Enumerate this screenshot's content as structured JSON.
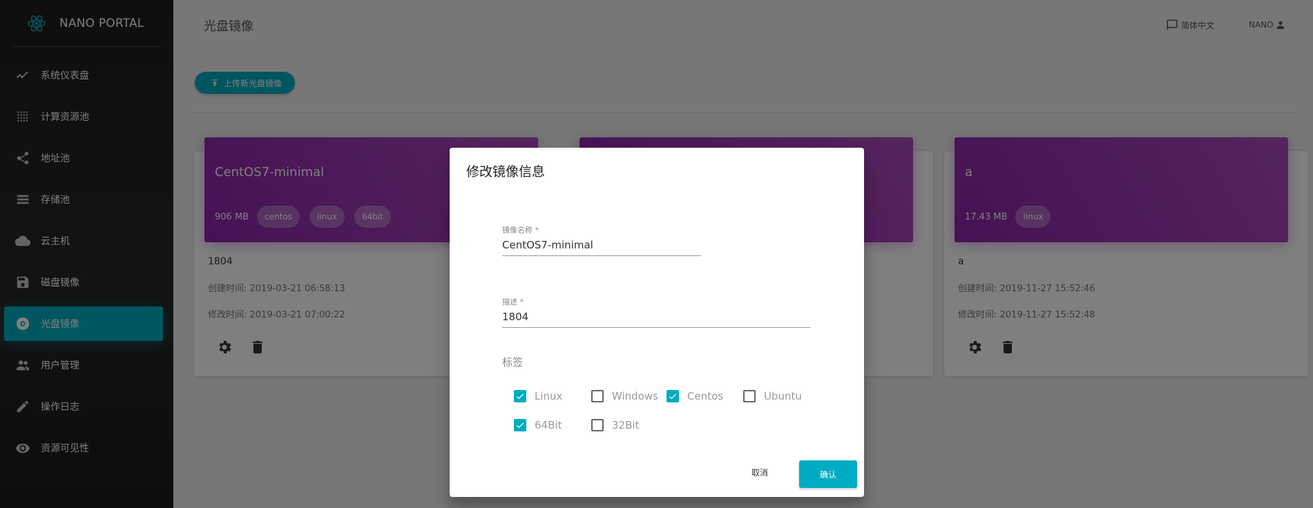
{
  "app": {
    "title": "NANO PORTAL",
    "logo_icon": "react-atom-icon"
  },
  "sidebar": {
    "items": [
      {
        "label": "系统仪表盘",
        "icon": "trending-icon"
      },
      {
        "label": "计算资源池",
        "icon": "grid-dots-icon"
      },
      {
        "label": "地址池",
        "icon": "share-icon"
      },
      {
        "label": "存储池",
        "icon": "storage-list-icon"
      },
      {
        "label": "云主机",
        "icon": "cloud-icon"
      },
      {
        "label": "磁盘镜像",
        "icon": "save-disk-icon"
      },
      {
        "label": "光盘镜像",
        "icon": "disc-icon",
        "active": true
      },
      {
        "label": "用户管理",
        "icon": "people-icon"
      },
      {
        "label": "操作日志",
        "icon": "edit-icon"
      },
      {
        "label": "资源可见性",
        "icon": "eye-icon"
      }
    ],
    "active_color": "#00acc1"
  },
  "header": {
    "page_title": "光盘镜像",
    "language": "简体中文",
    "user": "NANO"
  },
  "toolbar": {
    "upload_label": "上传新光盘镜像"
  },
  "cards": [
    {
      "title": "CentOS7-minimal",
      "size": "906 MB",
      "tags": [
        "centos",
        "linux",
        "64bit"
      ],
      "description": "1804",
      "created": "创建时间: 2019-03-21 06:58:13",
      "modified": "修改时间: 2019-03-21 07:00:22"
    },
    {
      "title": "",
      "size": "",
      "tags": [],
      "description": "",
      "created": "",
      "modified": ""
    },
    {
      "title": "a",
      "size": "17.43 MB",
      "tags": [
        "linux"
      ],
      "description": "a",
      "created": "创建时间: 2019-11-27 15:52:46",
      "modified": "修改时间: 2019-11-27 15:52:48"
    }
  ],
  "card_header_color": "#9c27b0",
  "dialog": {
    "title": "修改镜像信息",
    "name_label": "镜像名称 *",
    "name_value": "CentOS7-minimal",
    "desc_label": "描述 *",
    "desc_value": "1804",
    "tags_label": "标签",
    "checkboxes": [
      {
        "label": "Linux",
        "checked": true
      },
      {
        "label": "Windows",
        "checked": false
      },
      {
        "label": "Centos",
        "checked": true
      },
      {
        "label": "Ubuntu",
        "checked": false
      },
      {
        "label": "64Bit",
        "checked": true
      },
      {
        "label": "32Bit",
        "checked": false
      }
    ],
    "cancel_label": "取消",
    "confirm_label": "确认"
  }
}
